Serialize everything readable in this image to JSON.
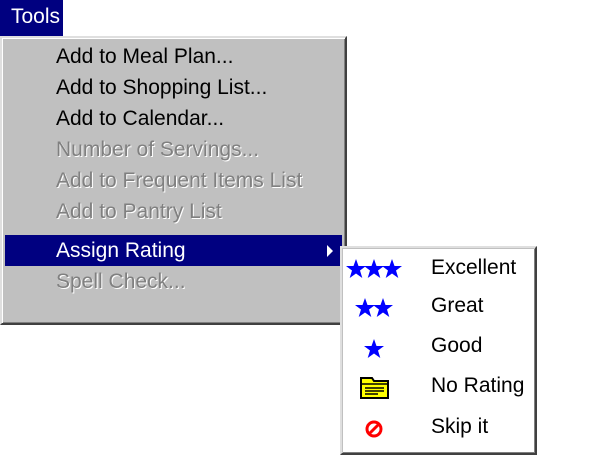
{
  "menubar": {
    "tools_label": "Tools"
  },
  "menu": {
    "items": [
      {
        "label": "Add to Meal Plan...",
        "enabled": true
      },
      {
        "label": "Add to Shopping List...",
        "enabled": true
      },
      {
        "label": "Add to Calendar...",
        "enabled": true
      },
      {
        "label": "Number of Servings...",
        "enabled": false
      },
      {
        "label": "Add to Frequent Items List",
        "enabled": false
      },
      {
        "label": "Add to Pantry List",
        "enabled": false
      },
      {
        "label": "Assign Rating",
        "enabled": true,
        "highlighted": true,
        "has_submenu": true
      },
      {
        "label": "Spell Check...",
        "enabled": false
      }
    ]
  },
  "submenu": {
    "items": [
      {
        "label": "Excellent",
        "icon": "three-stars-icon"
      },
      {
        "label": "Great",
        "icon": "two-stars-icon"
      },
      {
        "label": "Good",
        "icon": "one-star-icon"
      },
      {
        "label": "No Rating",
        "icon": "folder-icon"
      },
      {
        "label": "Skip it",
        "icon": "prohibited-icon"
      }
    ]
  },
  "colors": {
    "highlight": "#000080",
    "menu_bg": "#c0c0c0",
    "disabled_text": "#808080",
    "star": "#0000ff",
    "folder": "#ffff00",
    "prohibited": "#ff0000"
  }
}
